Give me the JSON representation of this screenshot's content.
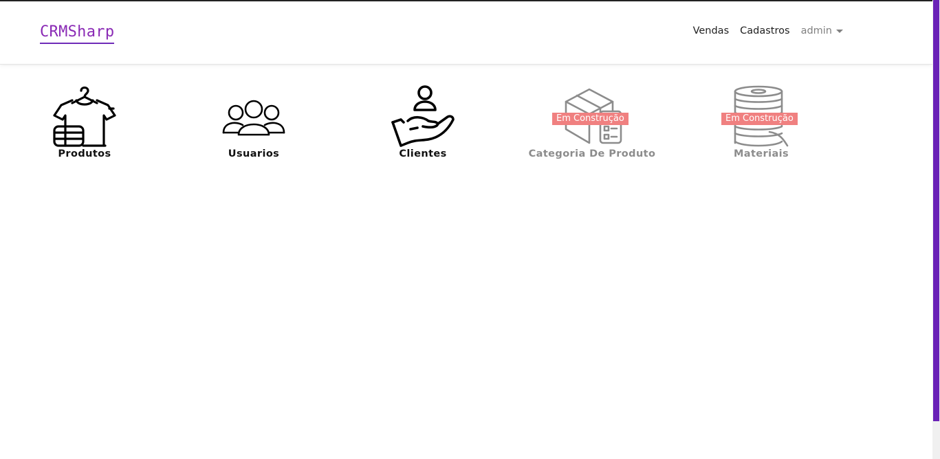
{
  "app": {
    "brand": "CRMSharp"
  },
  "nav": {
    "vendas": "Vendas",
    "cadastros": "Cadastros",
    "user": "admin"
  },
  "tiles": [
    {
      "label": "Produtos",
      "icon": "tshirt-hanger-icon",
      "enabled": true
    },
    {
      "label": "Usuarios",
      "icon": "users-group-icon",
      "enabled": true
    },
    {
      "label": "Clientes",
      "icon": "hand-person-icon",
      "enabled": true
    },
    {
      "label": "Categoria De Produto",
      "icon": "box-checklist-icon",
      "enabled": false,
      "badge": "Em Construção"
    },
    {
      "label": "Materiais",
      "icon": "thread-spool-icon",
      "enabled": false,
      "badge": "Em Construção"
    }
  ],
  "colors": {
    "brand": "#8a2ab5",
    "scrollbar": "#6a22b7",
    "badge": "#f08080",
    "disabled": "#8c8c8c"
  }
}
